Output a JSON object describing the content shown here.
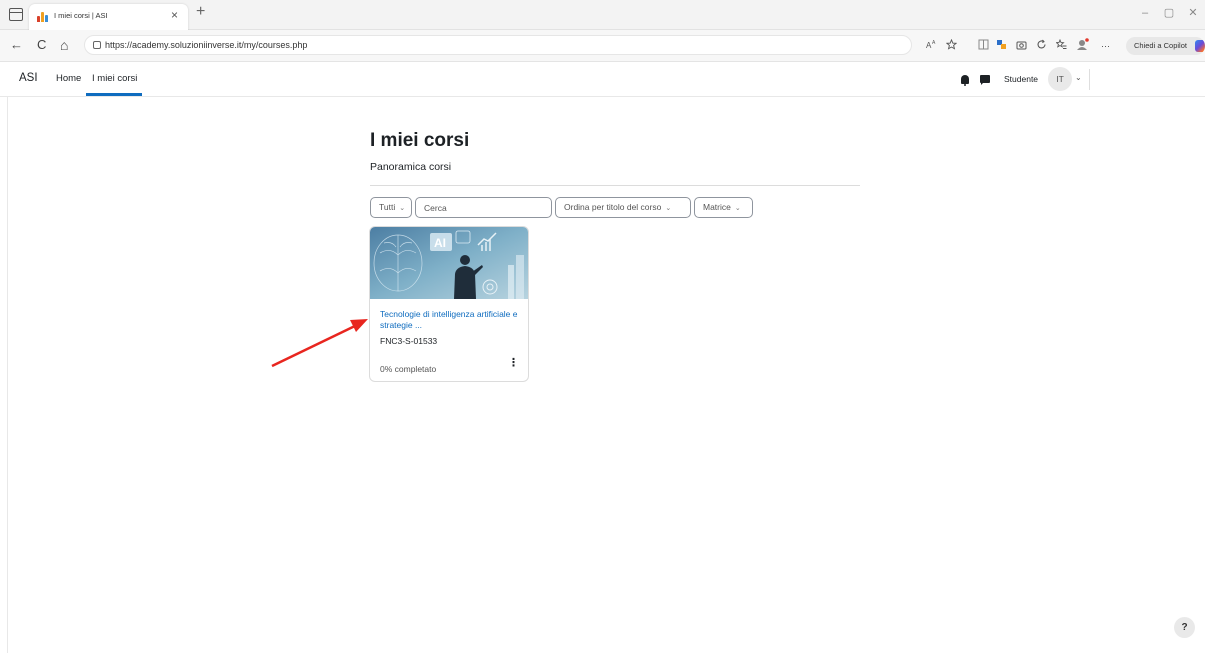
{
  "browser": {
    "tab_title": "I miei corsi | ASI",
    "tab_close": "×",
    "new_tab": "+",
    "window_controls": [
      "–",
      "▢",
      "✕"
    ],
    "url": "https://academy.soluzioniinverse.it/my/courses.php",
    "nav_back": "←",
    "nav_reload": "C",
    "nav_home": "⌂",
    "more_menu": "···",
    "copilot_label": "Chiedi a Copilot",
    "icons": [
      "read-aloud-icon",
      "favorite-star-icon",
      "split-screen-icon",
      "extension-icon",
      "screenshot-icon",
      "refresh-icon",
      "favorites-icon",
      "profile-icon",
      "more-icon"
    ]
  },
  "header": {
    "brand": "ASI",
    "nav": {
      "home": "Home",
      "my_courses": "I miei corsi"
    },
    "user_label": "Studente",
    "avatar_initials": "IT",
    "user_chevron": "⌄",
    "accent": "#0f6cbf"
  },
  "main": {
    "page_title": "I miei corsi",
    "section_title": "Panoramica corsi",
    "filters": {
      "grouping": "Tutti",
      "search_placeholder": "Cerca",
      "sort": "Ordina per titolo del corso",
      "view": "Matrice"
    },
    "courses": [
      {
        "name": "Tecnologie di intelligenza artificiale e strategie ...",
        "code": "FNC3-S-01533",
        "progress_text": "0% completato",
        "progress": 0,
        "image_icons": [
          "brain-icon",
          "ai-badge-icon",
          "person-silhouette-icon",
          "chart-icon"
        ],
        "image_badge": "AI"
      }
    ]
  },
  "help_label": "?",
  "annotation": {
    "arrow_color": "#e8261f"
  }
}
